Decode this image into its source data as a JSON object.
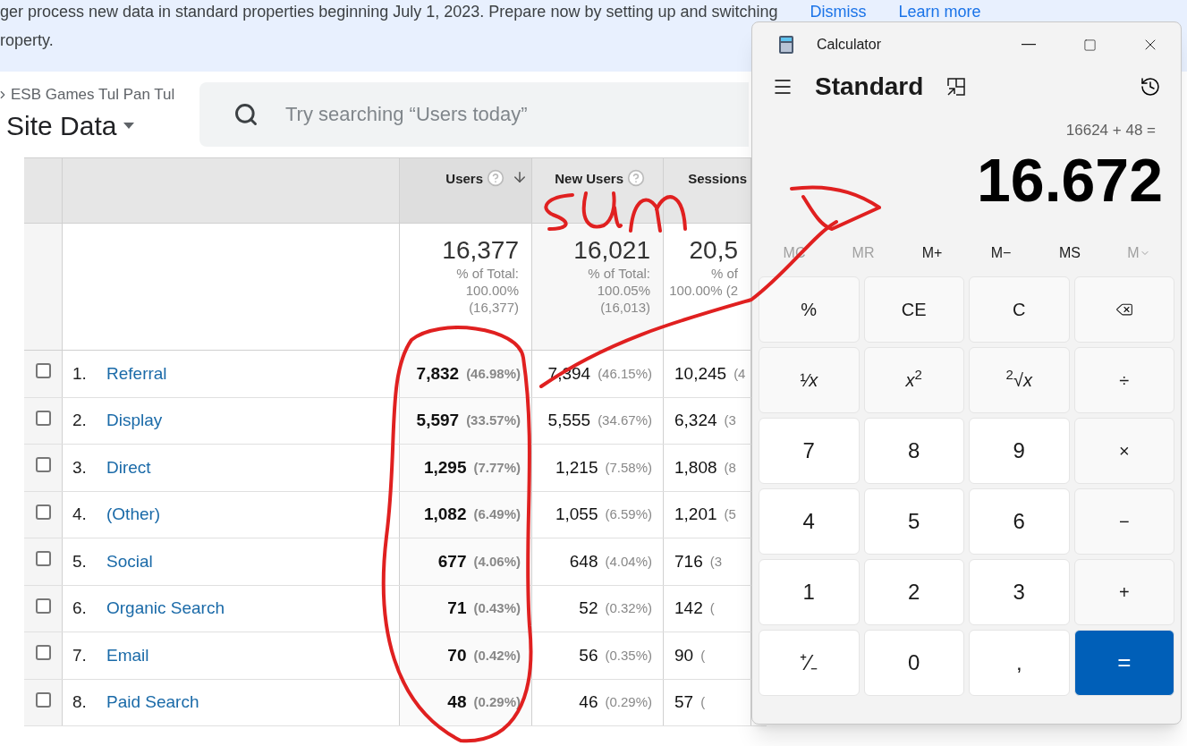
{
  "banner": {
    "text": "ger process new data in standard properties beginning July 1, 2023. Prepare now by setting up and switching",
    "text_line2": "roperty.",
    "links": [
      "Dismiss",
      "Learn more"
    ]
  },
  "header": {
    "breadcrumb": "ESB Games Tul Pan Tul",
    "title": "Site Data",
    "search": {
      "placeholder": "Try searching “Users today”"
    }
  },
  "table": {
    "columns": [
      {
        "label": "Users",
        "help": true,
        "sorted": true
      },
      {
        "label": "New Users",
        "help": true,
        "sorted": false
      },
      {
        "label": "Sessions",
        "help": false,
        "sorted": false
      }
    ],
    "totals": [
      {
        "value": "16,377",
        "lines": [
          "% of Total:",
          "100.00%",
          "(16,377)"
        ]
      },
      {
        "value": "16,021",
        "lines": [
          "% of Total:",
          "100.05%",
          "(16,013)"
        ]
      },
      {
        "value": "20,5",
        "lines": [
          "% of",
          "100.00% (2"
        ]
      }
    ],
    "rows": [
      {
        "checked": false,
        "index": "1.",
        "name": "Referral",
        "cells": [
          {
            "value": "7,832",
            "pct": "(46.98%)"
          },
          {
            "value": "7,394",
            "pct": "(46.15%)"
          },
          {
            "value": "10,245",
            "pct": "(4"
          }
        ]
      },
      {
        "checked": false,
        "index": "2.",
        "name": "Display",
        "cells": [
          {
            "value": "5,597",
            "pct": "(33.57%)"
          },
          {
            "value": "5,555",
            "pct": "(34.67%)"
          },
          {
            "value": "6,324",
            "pct": "(3"
          }
        ]
      },
      {
        "checked": false,
        "index": "3.",
        "name": "Direct",
        "cells": [
          {
            "value": "1,295",
            "pct": "(7.77%)"
          },
          {
            "value": "1,215",
            "pct": "(7.58%)"
          },
          {
            "value": "1,808",
            "pct": "(8"
          }
        ]
      },
      {
        "checked": false,
        "index": "4.",
        "name": "(Other)",
        "cells": [
          {
            "value": "1,082",
            "pct": "(6.49%)"
          },
          {
            "value": "1,055",
            "pct": "(6.59%)"
          },
          {
            "value": "1,201",
            "pct": "(5"
          }
        ]
      },
      {
        "checked": false,
        "index": "5.",
        "name": "Social",
        "cells": [
          {
            "value": "677",
            "pct": "(4.06%)"
          },
          {
            "value": "648",
            "pct": "(4.04%)"
          },
          {
            "value": "716",
            "pct": "(3"
          }
        ]
      },
      {
        "checked": false,
        "index": "6.",
        "name": "Organic Search",
        "cells": [
          {
            "value": "71",
            "pct": "(0.43%)"
          },
          {
            "value": "52",
            "pct": "(0.32%)"
          },
          {
            "value": "142",
            "pct": "("
          }
        ]
      },
      {
        "checked": false,
        "index": "7.",
        "name": "Email",
        "cells": [
          {
            "value": "70",
            "pct": "(0.42%)"
          },
          {
            "value": "56",
            "pct": "(0.35%)"
          },
          {
            "value": "90",
            "pct": "("
          }
        ]
      },
      {
        "checked": false,
        "index": "8.",
        "name": "Paid Search",
        "cells": [
          {
            "value": "48",
            "pct": "(0.29%)"
          },
          {
            "value": "46",
            "pct": "(0.29%)"
          },
          {
            "value": "57",
            "pct": "("
          }
        ]
      }
    ]
  },
  "calculator": {
    "title": "Calculator",
    "mode": "Standard",
    "expression": "16624 + 48 =",
    "result": "16.672",
    "memory": [
      {
        "label": "MC",
        "disabled": true
      },
      {
        "label": "MR",
        "disabled": true
      },
      {
        "label": "M+",
        "disabled": false
      },
      {
        "label": "M−",
        "disabled": false
      },
      {
        "label": "MS",
        "disabled": false
      },
      {
        "label": "M",
        "disabled": true,
        "kind": "menu"
      }
    ],
    "keys": [
      {
        "label": "%",
        "kind": "function"
      },
      {
        "label": "CE",
        "kind": "function"
      },
      {
        "label": "C",
        "kind": "function"
      },
      {
        "kind": "backspace"
      },
      {
        "label": "¹⁄*x*",
        "kind": "function"
      },
      {
        "label": "*x*$^{2}$",
        "kind": "function"
      },
      {
        "label": "$^{2}$√*x*",
        "kind": "function"
      },
      {
        "label": "÷",
        "kind": "function"
      },
      {
        "label": "7",
        "kind": "digit"
      },
      {
        "label": "8",
        "kind": "digit"
      },
      {
        "label": "9",
        "kind": "digit"
      },
      {
        "label": "×",
        "kind": "function"
      },
      {
        "label": "4",
        "kind": "digit"
      },
      {
        "label": "5",
        "kind": "digit"
      },
      {
        "label": "6",
        "kind": "digit"
      },
      {
        "label": "−",
        "kind": "function"
      },
      {
        "label": "1",
        "kind": "digit"
      },
      {
        "label": "2",
        "kind": "digit"
      },
      {
        "label": "3",
        "kind": "digit"
      },
      {
        "label": "+",
        "kind": "function"
      },
      {
        "label": "⁺⁄₋",
        "kind": "digit"
      },
      {
        "label": "0",
        "kind": "digit"
      },
      {
        "label": ",",
        "kind": "digit"
      },
      {
        "label": "=",
        "kind": "equals"
      }
    ]
  }
}
